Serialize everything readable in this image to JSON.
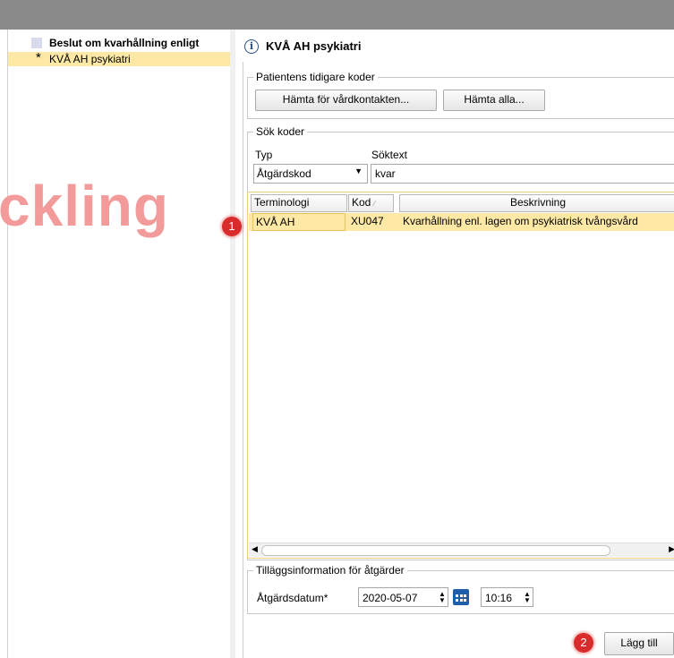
{
  "tree": {
    "items": [
      {
        "label": "Beslut om kvarhållning enligt",
        "bold": true,
        "selected": false,
        "marker": ""
      },
      {
        "label": "KVÅ AH psykiatri",
        "bold": false,
        "selected": true,
        "marker": "*"
      }
    ]
  },
  "watermark": "ckling",
  "header": {
    "title": "KVÅ AH psykiatri",
    "icon": "info-icon"
  },
  "previous_codes": {
    "legend": "Patientens tidigare koder",
    "fetch_contact_button": "Hämta för vårdkontakten...",
    "fetch_all_button": "Hämta alla..."
  },
  "search": {
    "legend": "Sök koder",
    "type_label": "Typ",
    "type_value": "Åtgärdskod",
    "text_label": "Söktext",
    "text_value": "kvar"
  },
  "results": {
    "columns": [
      "Terminologi",
      "Kod",
      "Beskrivning"
    ],
    "rows": [
      {
        "terminologi": "KVÅ AH",
        "kod": "XU047",
        "beskrivning": "Kvarhållning enl. lagen om psykiatrisk tvångsvård"
      }
    ]
  },
  "extra_info": {
    "legend": "Tilläggsinformation för åtgärder",
    "date_label": "Åtgärdsdatum*",
    "date_value": "2020-05-07",
    "time_value": "10:16"
  },
  "actions": {
    "add_button": "Lägg till"
  },
  "markers": [
    "1",
    "2"
  ],
  "colors": {
    "selection": "#fde9a5",
    "marker": "#d92b2b",
    "watermark": "#f39a9a",
    "topbar": "#8a8a8a"
  }
}
